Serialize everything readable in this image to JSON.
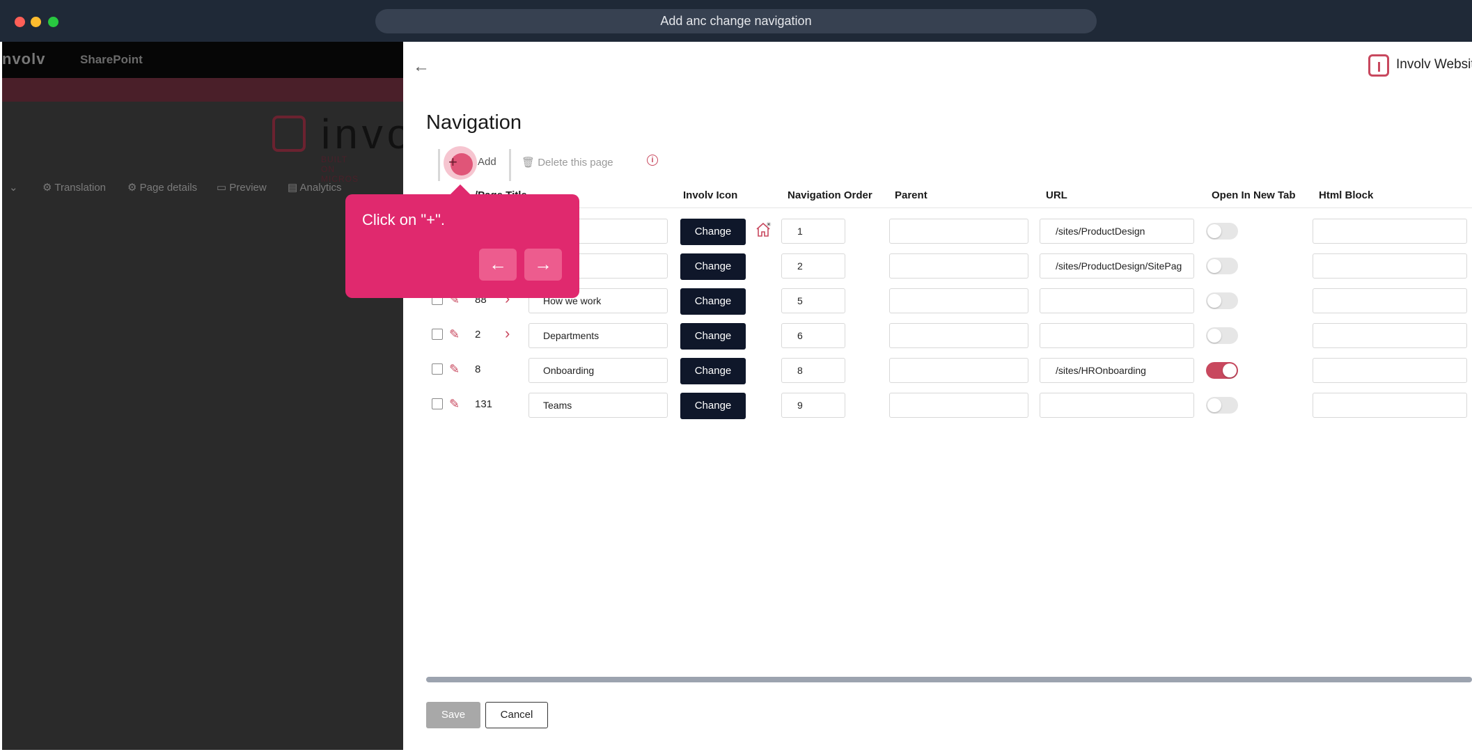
{
  "window": {
    "title": "Add anc change navigation"
  },
  "background": {
    "logo_text": "nvolv",
    "app_name": "SharePoint",
    "big_logo_text": "invo",
    "big_logo_sub": "BUILT ON MICROS",
    "command_bar": [
      {
        "label": "Translation",
        "icon": "translation-icon"
      },
      {
        "label": "Page details",
        "icon": "gear-icon"
      },
      {
        "label": "Preview",
        "icon": "preview-icon"
      },
      {
        "label": "Analytics",
        "icon": "analytics-icon"
      }
    ]
  },
  "panel": {
    "brand": "Involv Websit",
    "title": "Navigation",
    "toolbar": {
      "add_label": "Add",
      "delete_label": "Delete this page"
    },
    "headers": {
      "page_title": "/Page Title",
      "icon": "Involv Icon",
      "order": "Navigation Order",
      "parent": "Parent",
      "url": "URL",
      "new_tab": "Open In New Tab",
      "html_block": "Html Block"
    },
    "rows": [
      {
        "id": "",
        "title": "",
        "icon_label": "Change",
        "order": "1",
        "parent": "",
        "url": "/sites/ProductDesign",
        "new_tab": false,
        "has_children": false
      },
      {
        "id": "",
        "title": "who",
        "icon_label": "Change",
        "order": "2",
        "parent": "",
        "url": "/sites/ProductDesign/SitePag",
        "new_tab": false,
        "has_children": false
      },
      {
        "id": "88",
        "title": "How we work",
        "icon_label": "Change",
        "order": "5",
        "parent": "",
        "url": "",
        "new_tab": false,
        "has_children": true
      },
      {
        "id": "2",
        "title": "Departments",
        "icon_label": "Change",
        "order": "6",
        "parent": "",
        "url": "",
        "new_tab": false,
        "has_children": true
      },
      {
        "id": "8",
        "title": "Onboarding",
        "icon_label": "Change",
        "order": "8",
        "parent": "",
        "url": "/sites/HROnboarding",
        "new_tab": true,
        "has_children": false
      },
      {
        "id": "131",
        "title": "Teams",
        "icon_label": "Change",
        "order": "9",
        "parent": "",
        "url": "",
        "new_tab": false,
        "has_children": false
      }
    ],
    "save_label": "Save",
    "cancel_label": "Cancel"
  },
  "tooltip": {
    "text": "Click on \"+\"."
  },
  "colors": {
    "accent": "#c8485e",
    "tooltip": "#e0296e",
    "dark_button": "#0f172a"
  }
}
